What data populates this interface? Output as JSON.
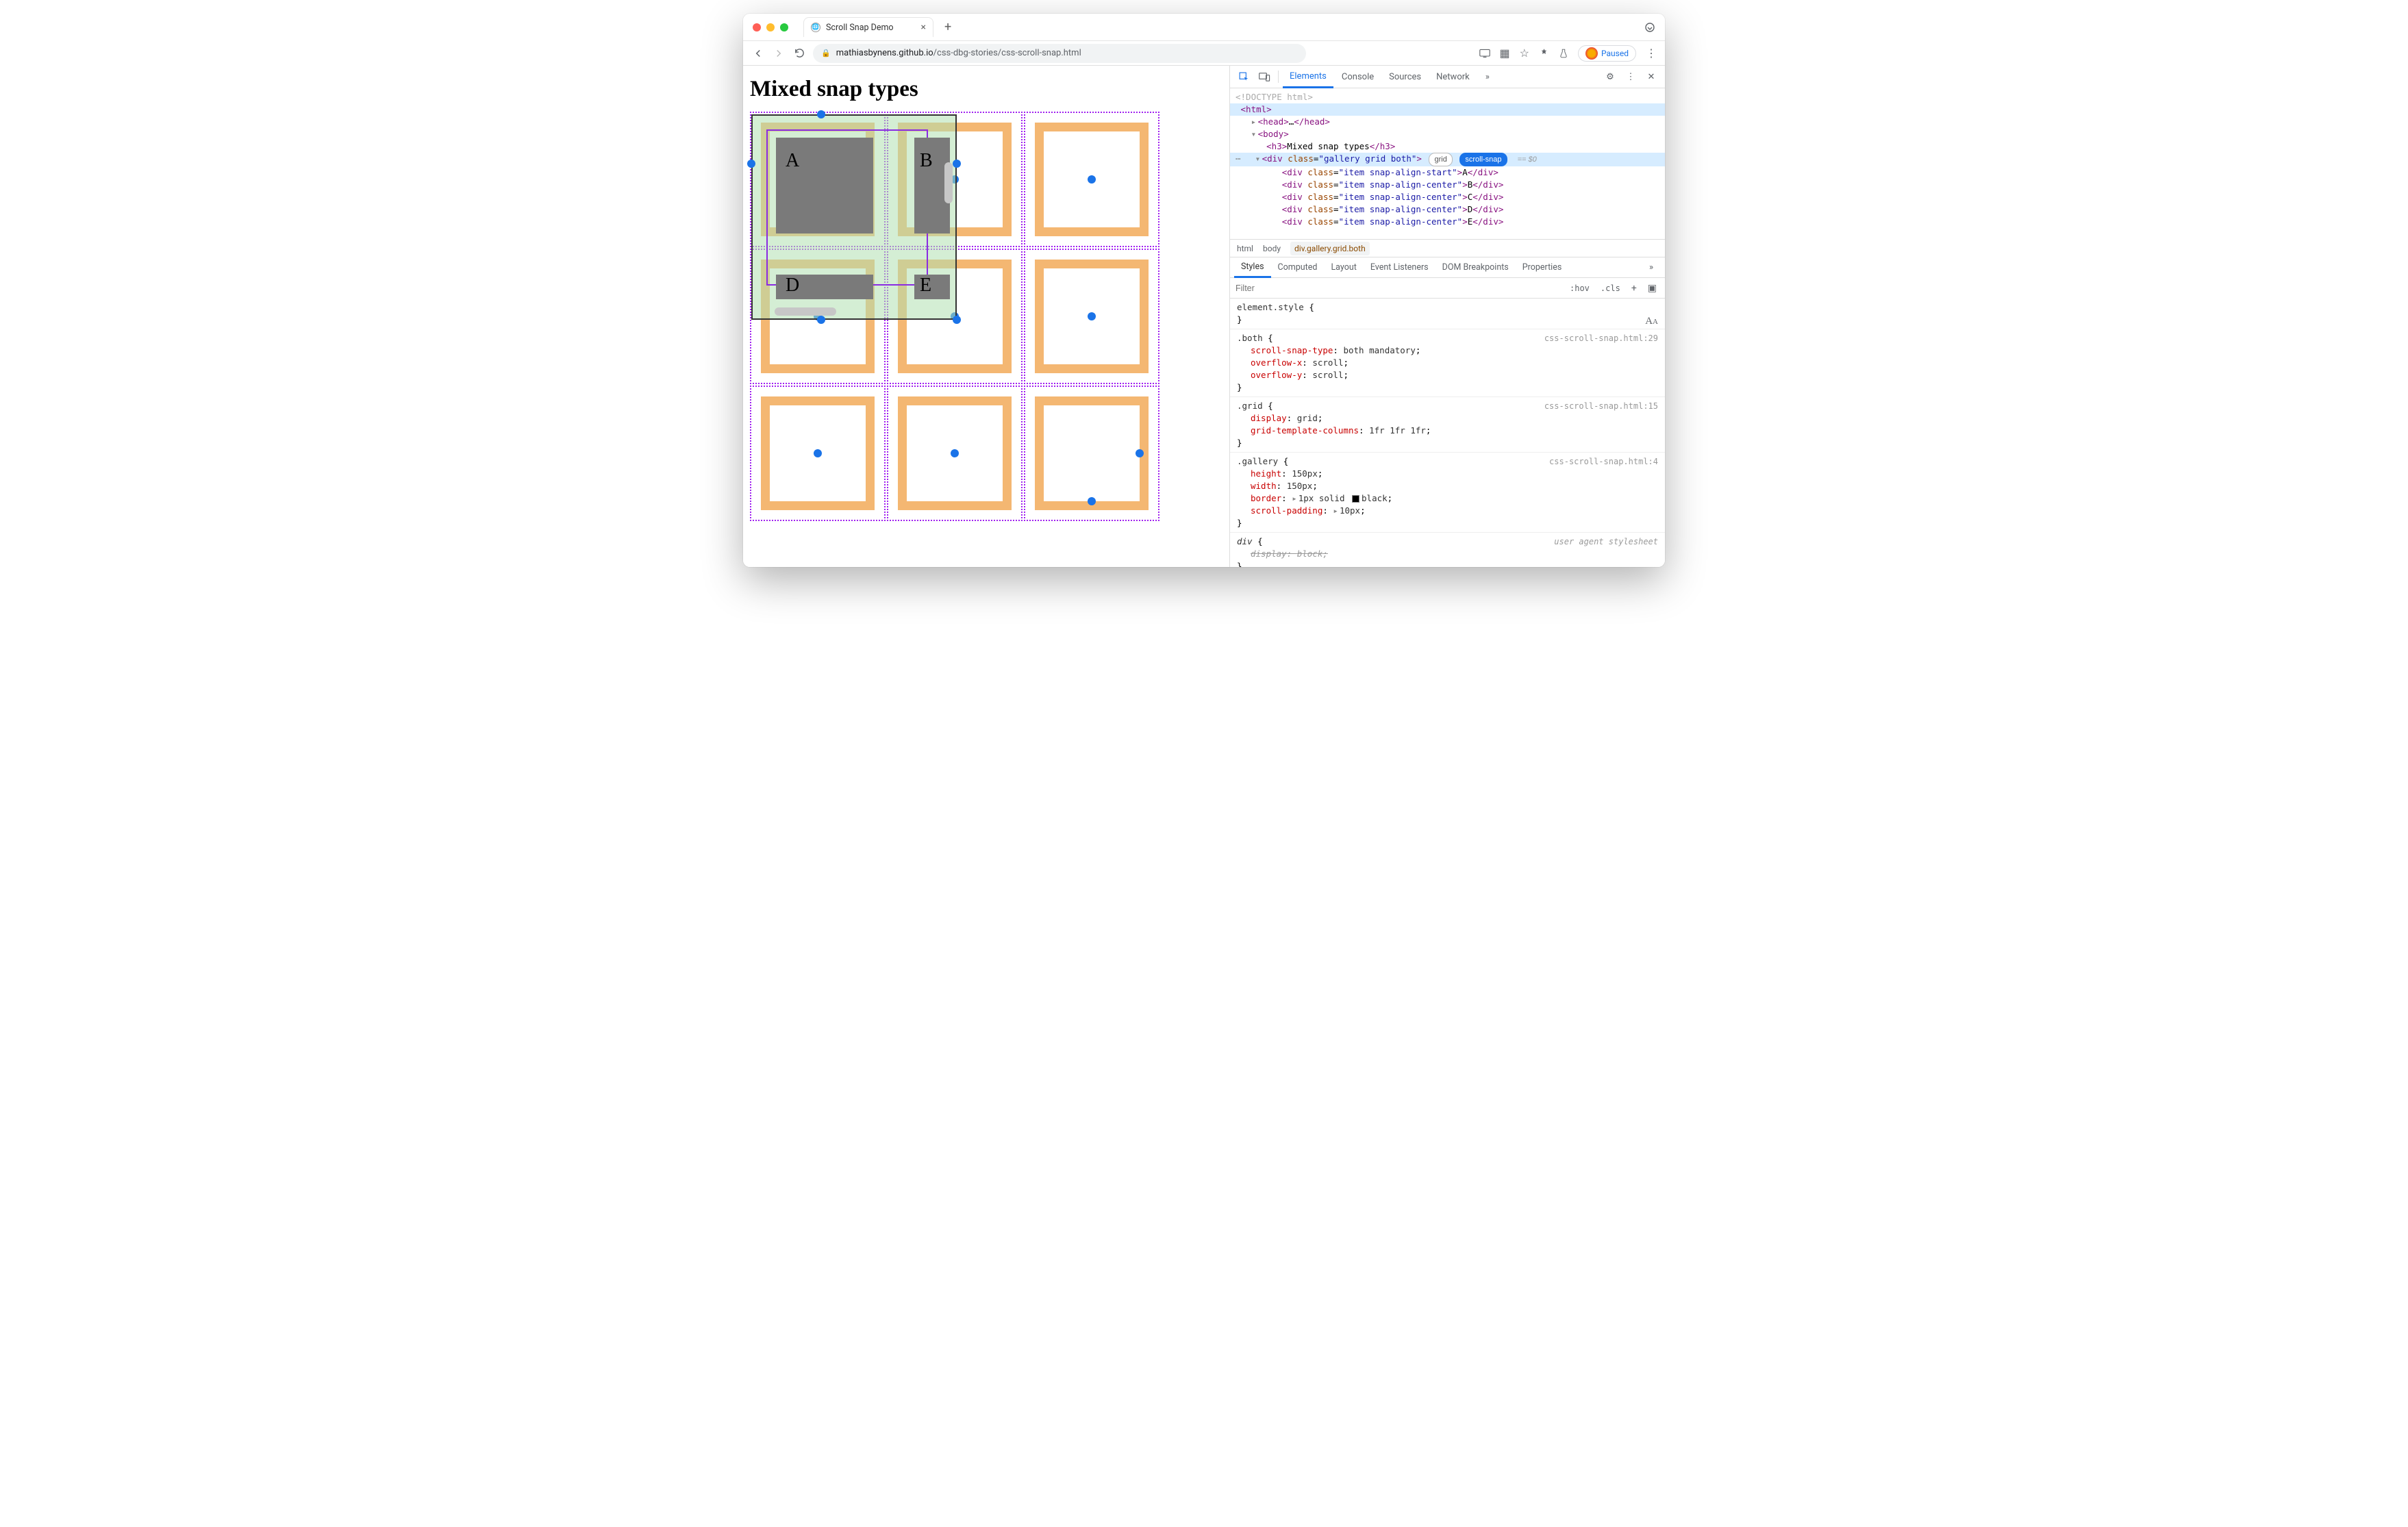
{
  "browser": {
    "tab_title": "Scroll Snap Demo",
    "url_host": "mathiasbynens.github.io",
    "url_path": "/css-dbg-stories/css-scroll-snap.html",
    "paused_label": "Paused"
  },
  "page": {
    "heading": "Mixed snap types",
    "cell_labels": {
      "a": "A",
      "b": "B",
      "d": "D",
      "e": "E"
    }
  },
  "devtools": {
    "tabs": [
      "Elements",
      "Console",
      "Sources",
      "Network"
    ],
    "active_tab": "Elements",
    "dom": {
      "doctype": "<!DOCTYPE html>",
      "html_open": "<html>",
      "head": {
        "open": "<head>",
        "ellipsis": "…",
        "close": "</head>"
      },
      "body_open": "<body>",
      "h3": {
        "open": "<h3>",
        "text": "Mixed snap types",
        "close": "</h3>"
      },
      "gallery": {
        "tag": "div",
        "class_attr": "gallery grid both",
        "badge_grid": "grid",
        "badge_snap": "scroll-snap",
        "eq": "== $0"
      },
      "items": [
        {
          "class": "item snap-align-start",
          "text": "A"
        },
        {
          "class": "item snap-align-center",
          "text": "B"
        },
        {
          "class": "item snap-align-center",
          "text": "C"
        },
        {
          "class": "item snap-align-center",
          "text": "D"
        },
        {
          "class": "item snap-align-center",
          "text": "E"
        }
      ]
    },
    "crumbs": [
      "html",
      "body",
      "div.gallery.grid.both"
    ],
    "sub_tabs": [
      "Styles",
      "Computed",
      "Layout",
      "Event Listeners",
      "DOM Breakpoints",
      "Properties"
    ],
    "active_sub_tab": "Styles",
    "filter_placeholder": "Filter",
    "hov_label": ":hov",
    "cls_label": ".cls",
    "rules": [
      {
        "selector": "element.style",
        "source": "",
        "props": []
      },
      {
        "selector": ".both",
        "source": "css-scroll-snap.html:29",
        "props": [
          {
            "name": "scroll-snap-type",
            "value": "both mandatory"
          },
          {
            "name": "overflow-x",
            "value": "scroll"
          },
          {
            "name": "overflow-y",
            "value": "scroll"
          }
        ]
      },
      {
        "selector": ".grid",
        "source": "css-scroll-snap.html:15",
        "props": [
          {
            "name": "display",
            "value": "grid"
          },
          {
            "name": "grid-template-columns",
            "value": "1fr 1fr 1fr"
          }
        ]
      },
      {
        "selector": ".gallery",
        "source": "css-scroll-snap.html:4",
        "props": [
          {
            "name": "height",
            "value": "150px"
          },
          {
            "name": "width",
            "value": "150px"
          },
          {
            "name": "border",
            "value": "1px solid ■ black",
            "expand": true,
            "swatch": true
          },
          {
            "name": "scroll-padding",
            "value": "10px",
            "expand": true
          }
        ]
      },
      {
        "selector": "div",
        "source": "user agent stylesheet",
        "ua": true,
        "props": [
          {
            "name": "display",
            "value": "block",
            "struck": true
          }
        ]
      }
    ]
  }
}
